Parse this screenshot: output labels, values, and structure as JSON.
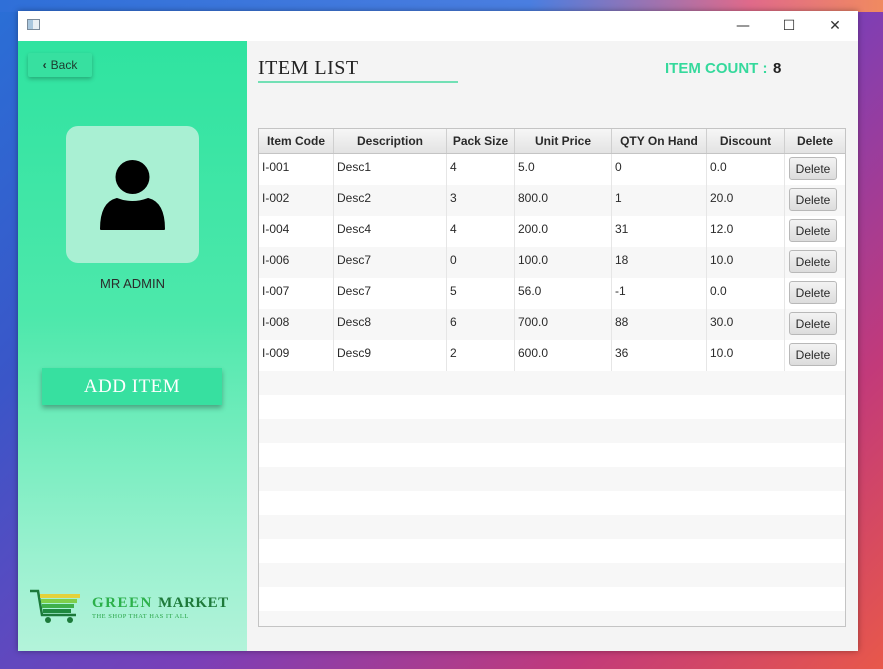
{
  "sidebar": {
    "back_label": "Back",
    "admin_name": "MR ADMIN",
    "add_item_label": "ADD ITEM",
    "logo_name_a": "GREEN",
    "logo_name_b": "MARKET",
    "logo_tagline": "THE SHOP THAT HAS IT ALL",
    "accent": "#37e0a0"
  },
  "content": {
    "title": "ITEM LIST",
    "count_label": "ITEM COUNT :",
    "count_value": "8"
  },
  "table": {
    "columns": [
      "Item Code",
      "Description",
      "Pack Size",
      "Unit Price",
      "QTY On Hand",
      "Discount",
      "Delete"
    ],
    "rows": [
      [
        "I-001",
        "Desc1",
        "4",
        "5.0",
        "0",
        "0.0"
      ],
      [
        "I-002",
        "Desc2",
        "3",
        "800.0",
        "1",
        "20.0"
      ],
      [
        "I-004",
        "Desc4",
        "4",
        "200.0",
        "31",
        "12.0"
      ],
      [
        "I-006",
        "Desc7",
        "0",
        "100.0",
        "18",
        "10.0"
      ],
      [
        "I-007",
        "Desc7",
        "5",
        "56.0",
        "-1",
        "0.0"
      ],
      [
        "I-008",
        "Desc8",
        "6",
        "700.0",
        "88",
        "30.0"
      ],
      [
        "I-009",
        "Desc9",
        "2",
        "600.0",
        "36",
        "10.0"
      ]
    ],
    "delete_label": "Delete"
  }
}
